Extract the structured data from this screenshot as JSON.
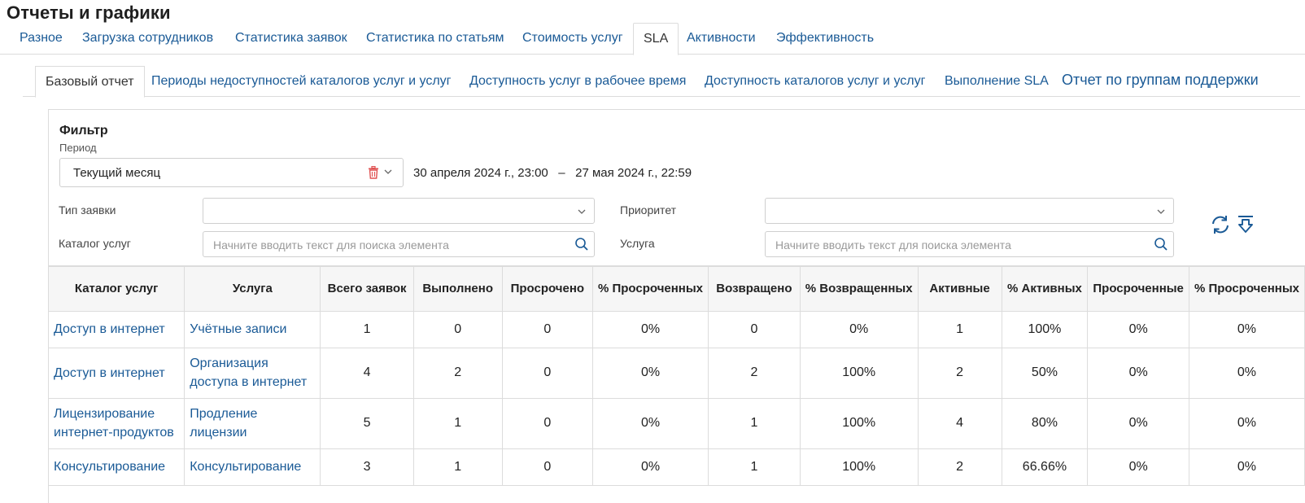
{
  "page": {
    "title": "Отчеты и графики"
  },
  "main_tabs": [
    {
      "label": "Разное",
      "active": false
    },
    {
      "label": "Загрузка сотрудников",
      "active": false
    },
    {
      "label": "Статистика заявок",
      "active": false
    },
    {
      "label": "Статистика по статьям",
      "active": false
    },
    {
      "label": "Стоимость услуг",
      "active": false
    },
    {
      "label": "SLA",
      "active": true
    },
    {
      "label": "Активности",
      "active": false
    },
    {
      "label": "Эффективность",
      "active": false
    }
  ],
  "sub_tabs": [
    {
      "label": "Базовый отчет",
      "active": true
    },
    {
      "label": "Периоды недоступностей каталогов услуг и услуг",
      "active": false
    },
    {
      "label": "Доступность услуг в рабочее время",
      "active": false
    },
    {
      "label": "Доступность каталогов услуг и услуг",
      "active": false
    },
    {
      "label": "Выполнение SLA",
      "active": false
    },
    {
      "label": "Отчет по группам поддержки",
      "active": false
    }
  ],
  "filter": {
    "title": "Фильтр",
    "period_label": "Период",
    "period_value": "Текущий месяц",
    "date_range": "30 апреля 2024 г., 23:00   –   27 мая 2024 г., 22:59",
    "request_type_label": "Тип заявки",
    "request_type_value": "",
    "priority_label": "Приоритет",
    "priority_value": "",
    "catalog_label": "Каталог услуг",
    "catalog_placeholder": "Начните вводить текст для поиска элемента",
    "service_label": "Услуга",
    "service_placeholder": "Начните вводить текст для поиска элемента"
  },
  "icons": {
    "clear": "trash-icon",
    "dropdown": "chevron-down-icon",
    "search": "search-icon",
    "refresh": "refresh-icon",
    "export": "download-icon"
  },
  "colors": {
    "link": "#1a5a96",
    "trash": "#e05252",
    "border": "#dcdcdc",
    "header_bg": "#f6f6f6"
  },
  "table": {
    "columns": [
      "Каталог услуг",
      "Услуга",
      "Всего заявок",
      "Выполнено",
      "Просрочено",
      "% Просроченных",
      "Возвращено",
      "% Возвращенных",
      "Активные",
      "% Активных",
      "Просроченные",
      "% Просроченных"
    ],
    "rows": [
      [
        "Доступ в интернет",
        "Учётные записи",
        "1",
        "0",
        "0",
        "0%",
        "0",
        "0%",
        "1",
        "100%",
        "0%",
        "0%"
      ],
      [
        "Доступ в интернет",
        "Организация доступа в интернет",
        "4",
        "2",
        "0",
        "0%",
        "2",
        "100%",
        "2",
        "50%",
        "0%",
        "0%"
      ],
      [
        "Лицензирование интернет-продуктов",
        "Продление лицензии",
        "5",
        "1",
        "0",
        "0%",
        "1",
        "100%",
        "4",
        "80%",
        "0%",
        "0%"
      ],
      [
        "Консультирование",
        "Консультирование",
        "3",
        "1",
        "0",
        "0%",
        "1",
        "100%",
        "2",
        "66.66%",
        "0%",
        "0%"
      ]
    ]
  }
}
